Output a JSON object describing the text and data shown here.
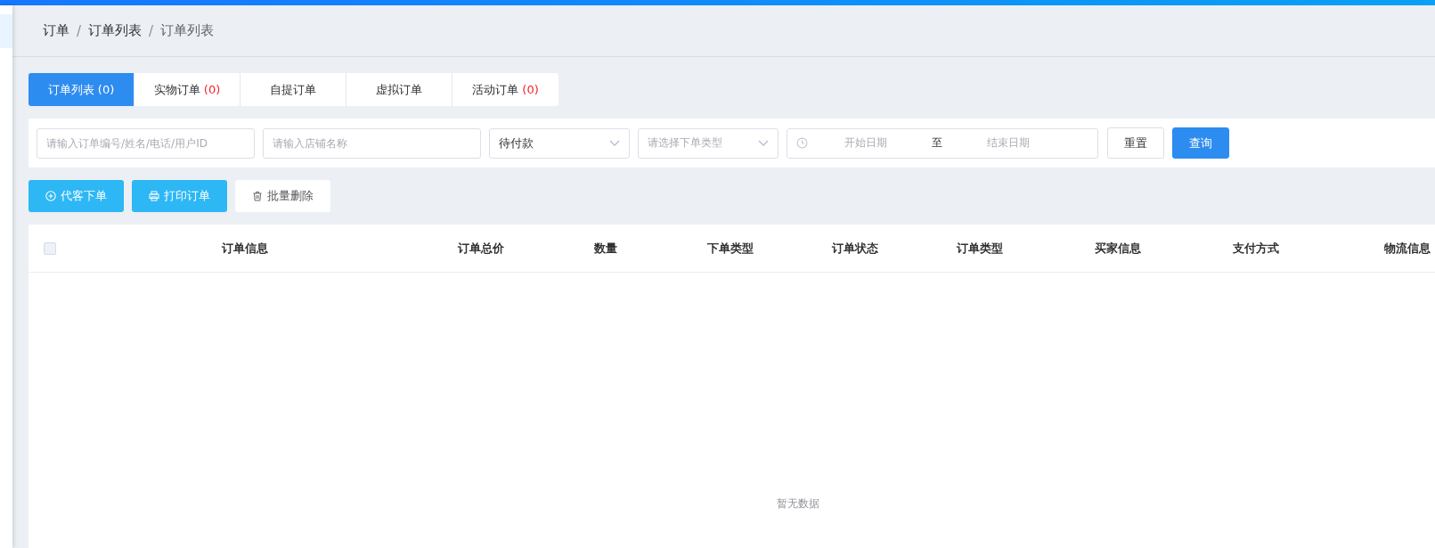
{
  "breadcrumb": [
    "订单",
    "订单列表",
    "订单列表"
  ],
  "breadcrumb_separator": "/",
  "tabs": [
    {
      "label": "订单列表",
      "count": "(0)",
      "selected": true
    },
    {
      "label": "实物订单",
      "count": "(0)",
      "selected": false
    },
    {
      "label": "自提订单",
      "selected": false
    },
    {
      "label": "虚拟订单",
      "selected": false
    },
    {
      "label": "活动订单",
      "count": "(0)",
      "selected": false
    }
  ],
  "filters": {
    "order_search": {
      "placeholder": "请输入订单编号/姓名/电话/用户ID"
    },
    "store_search": {
      "placeholder": "请输入店铺名称"
    },
    "status_select": {
      "value": "待付款"
    },
    "type_select": {
      "placeholder": "请选择下单类型"
    },
    "date_range": {
      "start_placeholder": "开始日期",
      "separator": "至",
      "end_placeholder": "结束日期"
    },
    "reset_button": "重置",
    "query_button": "查询"
  },
  "actions": [
    {
      "label": "代客下单",
      "kind": "add"
    },
    {
      "label": "打印订单",
      "kind": "print"
    },
    {
      "label": "批量删除",
      "kind": "delete"
    }
  ],
  "table": {
    "select_all_checked": false,
    "columns": [
      "订单信息",
      "订单总价",
      "数量",
      "下单类型",
      "订单状态",
      "订单类型",
      "买家信息",
      "支付方式",
      "物流信息"
    ],
    "empty_text": "暂无数据"
  }
}
